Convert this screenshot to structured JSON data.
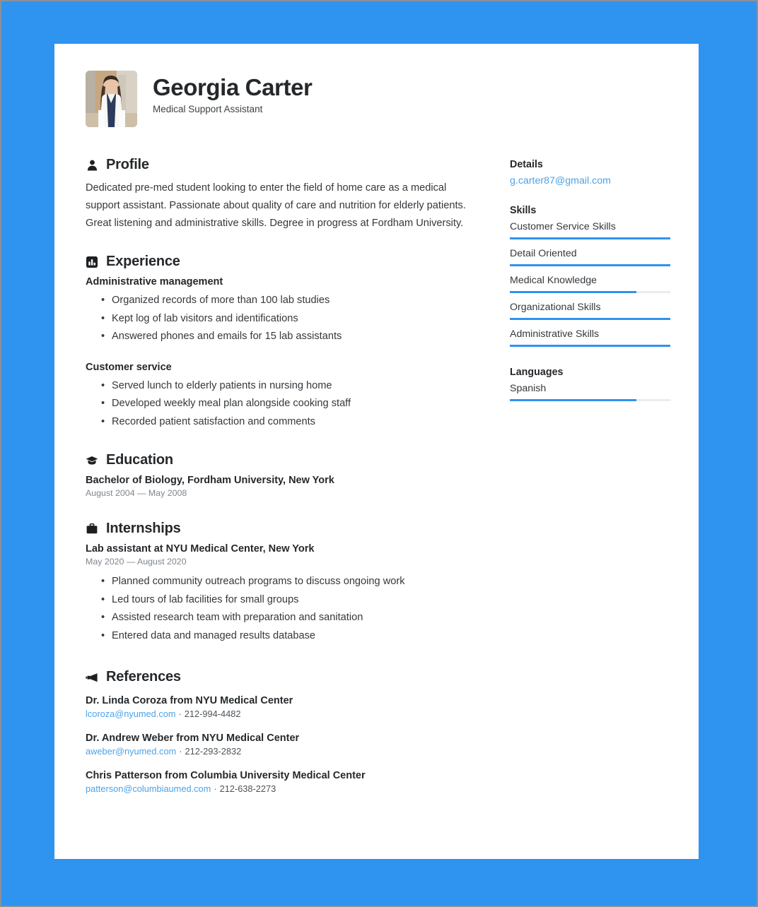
{
  "theme": {
    "background": "#2f93f0",
    "page_background": "#ffffff",
    "accent": "#2f93f0",
    "link": "#4ba3e8",
    "text": "#34383c",
    "heading": "#25282b",
    "muted": "#7f868d"
  },
  "header": {
    "name": "Georgia Carter",
    "job_title": "Medical Support Assistant",
    "avatar_alt": "profile-photo"
  },
  "sections": {
    "profile": {
      "icon": "person-icon",
      "title": "Profile",
      "text": "Dedicated pre-med student looking to enter the field of home care as a medical support assistant. Passionate about quality of care and nutrition for elderly patients. Great listening and administrative skills. Degree in progress at Fordham University."
    },
    "experience": {
      "icon": "bar-chart-icon",
      "title": "Experience",
      "entries": [
        {
          "title": "Administrative management",
          "bullets": [
            "Organized records of more than 100 lab studies",
            "Kept log of lab visitors and identifications",
            "Answered phones and emails for 15 lab assistants"
          ]
        },
        {
          "title": "Customer service",
          "bullets": [
            "Served lunch to elderly patients in nursing home",
            "Developed weekly meal plan alongside cooking staff",
            "Recorded patient satisfaction and comments"
          ]
        }
      ]
    },
    "education": {
      "icon": "graduation-cap-icon",
      "title": "Education",
      "entries": [
        {
          "title": "Bachelor of Biology, Fordham University, New York",
          "date": "August 2004 — May 2008"
        }
      ]
    },
    "internships": {
      "icon": "briefcase-icon",
      "title": "Internships",
      "entries": [
        {
          "title": "Lab assistant at NYU Medical Center, New York",
          "date": "May 2020 — August 2020",
          "bullets": [
            "Planned community outreach programs to discuss ongoing work",
            "Led tours of lab facilities for small groups",
            "Assisted research team with preparation and sanitation",
            "Entered data and managed results database"
          ]
        }
      ]
    },
    "references": {
      "icon": "megaphone-icon",
      "title": "References",
      "entries": [
        {
          "name": "Dr. Linda Coroza from NYU Medical Center",
          "email": "lcoroza@nyumed.com",
          "separator": "·",
          "phone": "212-994-4482"
        },
        {
          "name": "Dr. Andrew Weber from NYU Medical Center",
          "email": "aweber@nyumed.com",
          "separator": "·",
          "phone": "212-293-2832"
        },
        {
          "name": "Chris Patterson from Columbia University Medical Center",
          "email": "patterson@columbiaumed.com",
          "separator": "·",
          "phone": "212-638-2273"
        }
      ]
    }
  },
  "sidebar": {
    "details": {
      "heading": "Details",
      "email": "g.carter87@gmail.com"
    },
    "skills": {
      "heading": "Skills",
      "items": [
        {
          "label": "Customer Service Skills",
          "level": 100
        },
        {
          "label": "Detail Oriented",
          "level": 100
        },
        {
          "label": "Medical Knowledge",
          "level": 79
        },
        {
          "label": "Organizational Skills",
          "level": 100
        },
        {
          "label": "Administrative Skills",
          "level": 100
        }
      ]
    },
    "languages": {
      "heading": "Languages",
      "items": [
        {
          "label": "Spanish",
          "level": 79
        }
      ]
    }
  }
}
